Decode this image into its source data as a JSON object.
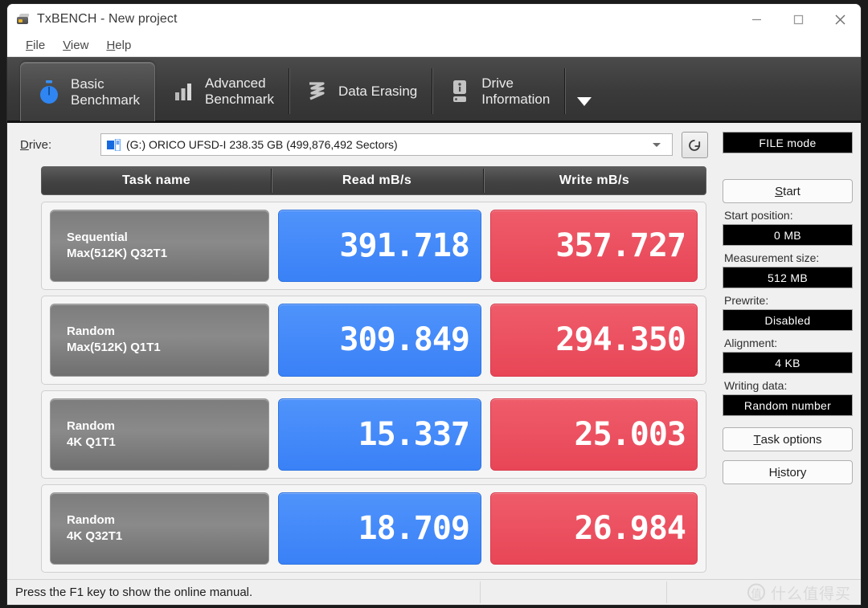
{
  "window": {
    "title": "TxBENCH - New project",
    "app_icon": "hdd-icon",
    "controls": {
      "minimize": "minimize-icon",
      "maximize": "maximize-icon",
      "close": "close-icon"
    }
  },
  "menubar": {
    "items": [
      {
        "label": "File",
        "mnemonic": "F"
      },
      {
        "label": "View",
        "mnemonic": "V"
      },
      {
        "label": "Help",
        "mnemonic": "H"
      }
    ]
  },
  "tabs": {
    "items": [
      {
        "label": "Basic\nBenchmark",
        "icon": "stopwatch-icon",
        "active": true
      },
      {
        "label": "Advanced\nBenchmark",
        "icon": "bar-chart-icon",
        "active": false
      },
      {
        "label": "Data Erasing",
        "icon": "shredder-icon",
        "active": false
      },
      {
        "label": "Drive\nInformation",
        "icon": "drive-info-icon",
        "active": false
      }
    ],
    "overflow_icon": "chevron-down-icon"
  },
  "drive": {
    "label": "Drive:",
    "label_mnemonic": "D",
    "value": "(G:) ORICO UFSD-I  238.35 GB (499,876,492 Sectors)",
    "icon": "disk-drive-icon",
    "dropdown_icon": "chevron-down-icon",
    "refresh_icon": "refresh-icon"
  },
  "results": {
    "headers": [
      "Task name",
      "Read mB/s",
      "Write mB/s"
    ],
    "rows": [
      {
        "name_line1": "Sequential",
        "name_line2": "Max(512K) Q32T1",
        "read": "391.718",
        "write": "357.727"
      },
      {
        "name_line1": "Random",
        "name_line2": "Max(512K) Q1T1",
        "read": "309.849",
        "write": "294.350"
      },
      {
        "name_line1": "Random",
        "name_line2": "4K Q1T1",
        "read": "15.337",
        "write": "25.003"
      },
      {
        "name_line1": "Random",
        "name_line2": "4K Q32T1",
        "read": "18.709",
        "write": "26.984"
      }
    ]
  },
  "sidebar": {
    "mode_button": "FILE mode",
    "start_button": "Start",
    "start_button_mnemonic": "S",
    "start_position_label": "Start position:",
    "start_position_value": "0 MB",
    "measurement_size_label": "Measurement size:",
    "measurement_size_value": "512 MB",
    "prewrite_label": "Prewrite:",
    "prewrite_value": "Disabled",
    "alignment_label": "Alignment:",
    "alignment_value": "4 KB",
    "writing_data_label": "Writing data:",
    "writing_data_value": "Random number",
    "task_options_button": "Task options",
    "task_options_mnemonic": "T",
    "history_button": "History",
    "history_mnemonic": "i"
  },
  "statusbar": {
    "text": "Press the F1 key to show the online manual.",
    "watermark_badge": "值",
    "watermark_text": "什么值得买"
  },
  "colors": {
    "read_blue": "#3a81f7",
    "write_red": "#e84657",
    "tab_bar_dark": "#3a3a3a",
    "lcd_background": "#000000",
    "window_background": "#f0f0f0"
  }
}
